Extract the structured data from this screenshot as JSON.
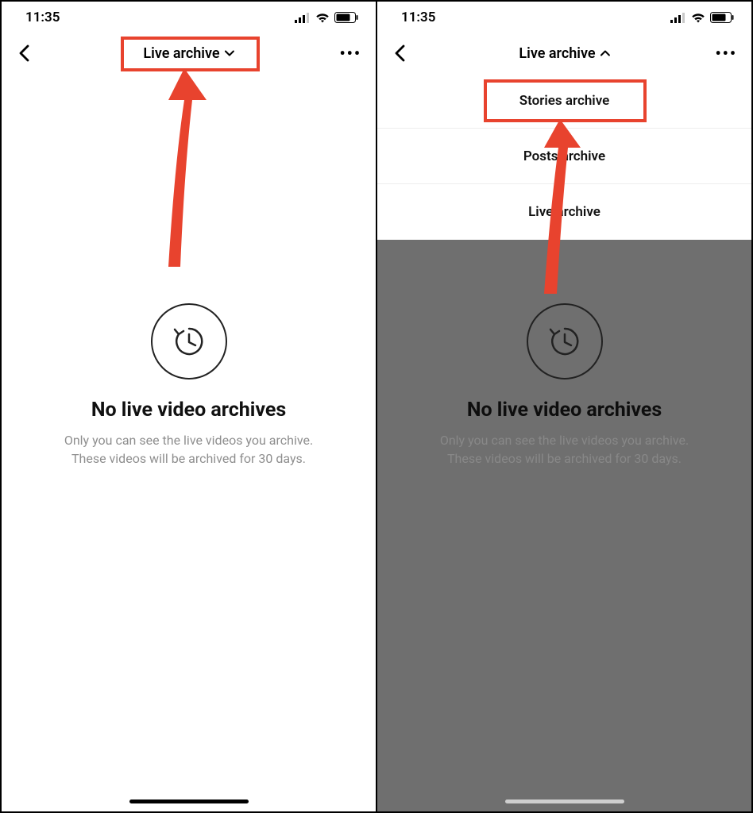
{
  "status": {
    "time": "11:35"
  },
  "nav": {
    "title_closed": "Live archive",
    "title_open": "Live archive"
  },
  "dropdown": {
    "items": [
      "Stories archive",
      "Posts archive",
      "Live archive"
    ]
  },
  "empty": {
    "title": "No live video archives",
    "sub1": "Only you can see the live videos you archive.",
    "sub2": "These videos will be archived for 30 days."
  }
}
